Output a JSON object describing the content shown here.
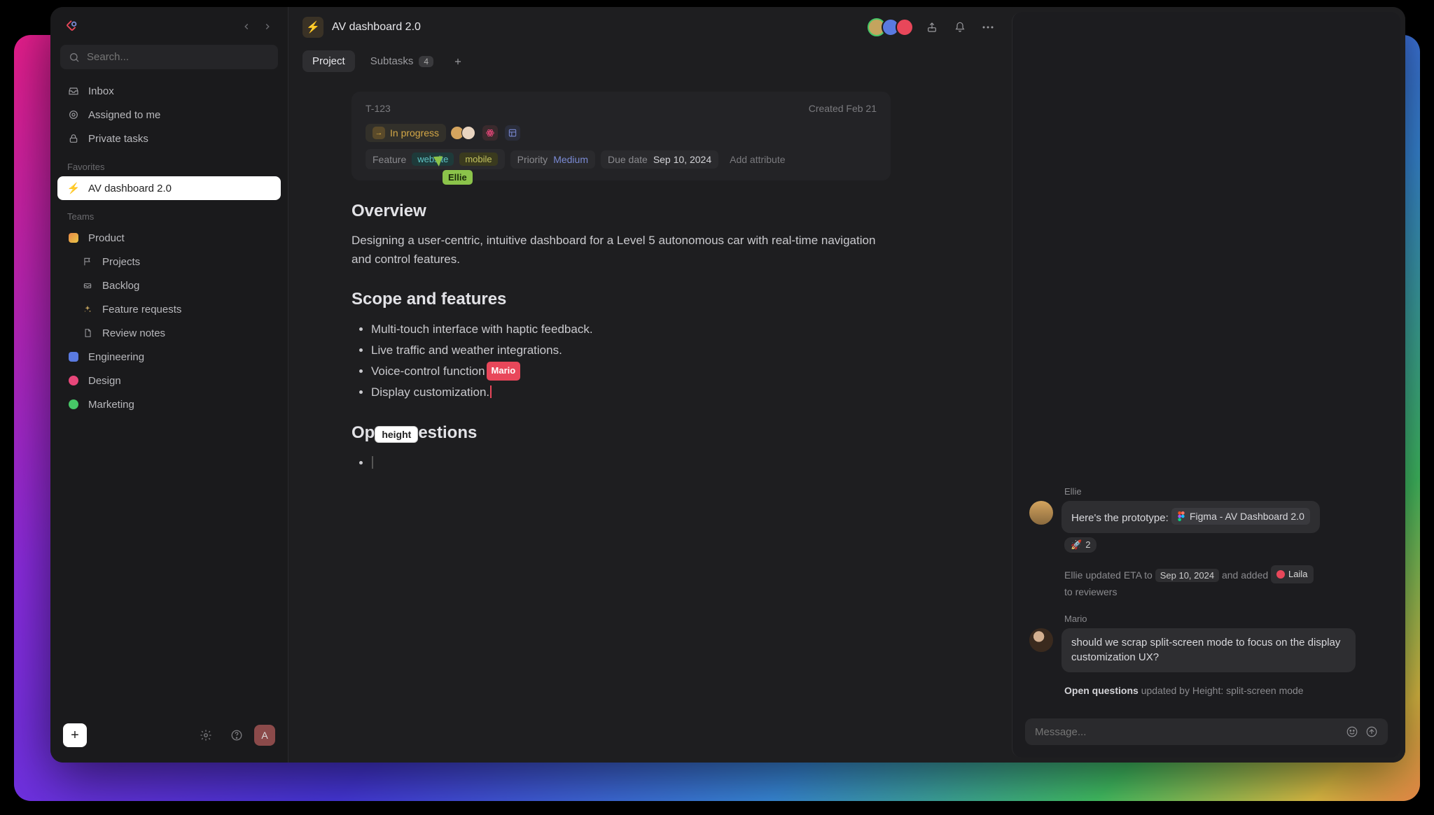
{
  "sidebar": {
    "search_placeholder": "Search...",
    "primary": [
      {
        "icon": "inbox",
        "label": "Inbox"
      },
      {
        "icon": "target",
        "label": "Assigned to me"
      },
      {
        "icon": "lock",
        "label": "Private tasks"
      }
    ],
    "favorites_label": "Favorites",
    "favorite": {
      "emoji": "⚡",
      "label": "AV dashboard 2.0"
    },
    "teams_label": "Teams",
    "teams": [
      {
        "icon": "orange-dot",
        "label": "Product",
        "items": [
          {
            "icon": "flag",
            "label": "Projects"
          },
          {
            "icon": "tray",
            "label": "Backlog"
          },
          {
            "icon": "sparkle",
            "label": "Feature requests"
          },
          {
            "icon": "doc",
            "label": "Review notes"
          }
        ]
      },
      {
        "icon": "blue-square",
        "label": "Engineering"
      },
      {
        "icon": "pink-dot",
        "label": "Design"
      },
      {
        "icon": "green-dot",
        "label": "Marketing"
      }
    ],
    "user_initial": "A"
  },
  "header": {
    "emoji": "⚡",
    "title": "AV dashboard 2.0",
    "collaborators": [
      "green",
      "blue",
      "red"
    ]
  },
  "tabs": {
    "project": "Project",
    "subtasks": "Subtasks",
    "subtasks_count": "4"
  },
  "task": {
    "id": "T-123",
    "created": "Created Feb 21",
    "status": "In progress",
    "attrs": {
      "feature_label": "Feature",
      "tag_website": "website",
      "tag_mobile": "mobile",
      "priority_label": "Priority",
      "priority_value": "Medium",
      "due_label": "Due date",
      "due_value": "Sep 10, 2024",
      "add_attr": "Add attribute"
    },
    "cursor_user": "Ellie"
  },
  "doc": {
    "overview_title": "Overview",
    "overview_body": "Designing a user-centric, intuitive dashboard for a Level 5 autonomous car with real-time navigation and control features.",
    "scope_title": "Scope and features",
    "scope_items": [
      "Multi-touch interface with haptic feedback.",
      "Live traffic and weather integrations.",
      "Voice-control function",
      "Display customization."
    ],
    "mario_label": "Mario",
    "openq_prefix": "Op",
    "height_label": "height",
    "openq_suffix": "estions"
  },
  "chat": {
    "msg1": {
      "author": "Ellie",
      "text_prefix": "Here's the prototype:",
      "figma_label": "Figma - AV Dashboard 2.0",
      "reaction_emoji": "🚀",
      "reaction_count": "2"
    },
    "activity1": {
      "prefix": "Ellie updated ETA to",
      "date": "Sep 10, 2024",
      "middle": "and added",
      "person": "Laila",
      "suffix": "to reviewers"
    },
    "msg2": {
      "author": "Mario",
      "text": "should we scrap split-screen mode to focus on the display customization UX?"
    },
    "activity2": {
      "bold": "Open questions",
      "rest": "updated by Height: split-screen mode"
    },
    "compose_placeholder": "Message..."
  }
}
